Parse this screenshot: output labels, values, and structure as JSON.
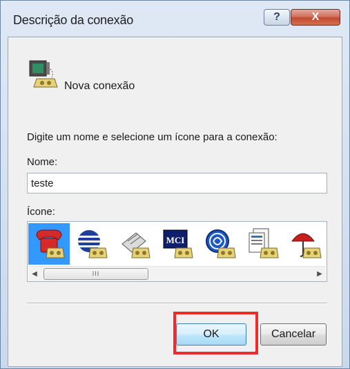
{
  "window": {
    "title": "Descrição da conexão",
    "help_label": "?",
    "close_label": "X"
  },
  "connection": {
    "name": "Nova conexão"
  },
  "form": {
    "instruction": "Digite um nome e selecione um ícone para a conexão:",
    "name_label": "Nome:",
    "name_value": "teste",
    "icon_label": "Ícone:"
  },
  "icon_list": {
    "items": [
      {
        "icon": "red-phone-icon",
        "selected": true
      },
      {
        "icon": "globe-phone-icon",
        "selected": false
      },
      {
        "icon": "fax-phone-icon",
        "selected": false
      },
      {
        "icon": "mci-phone-icon",
        "selected": false,
        "text": "MCI"
      },
      {
        "icon": "ge-phone-icon",
        "selected": false
      },
      {
        "icon": "documents-phone-icon",
        "selected": false
      },
      {
        "icon": "umbrella-phone-icon",
        "selected": false
      }
    ],
    "scroll_thumb": "III"
  },
  "buttons": {
    "ok": "OK",
    "cancel": "Cancelar"
  },
  "colors": {
    "selection": "#3399ff",
    "highlight": "#ee2b2b"
  }
}
